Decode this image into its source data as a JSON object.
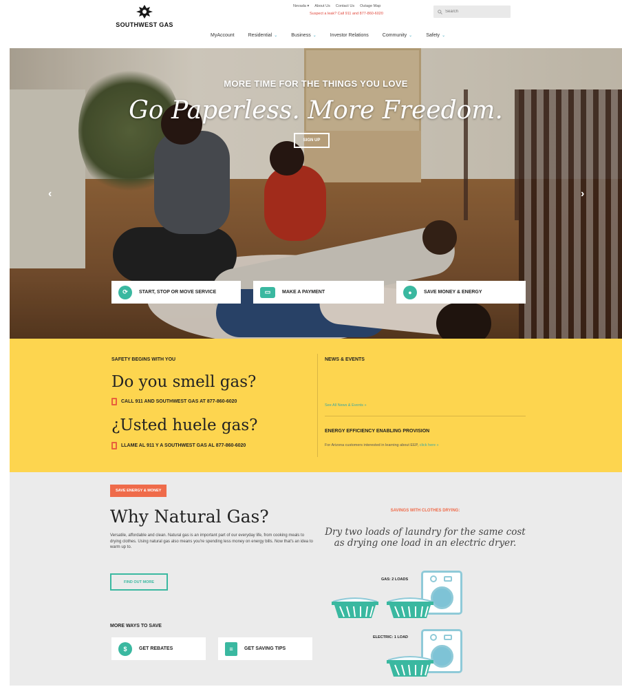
{
  "header": {
    "logo_text": "SOUTHWEST GAS",
    "utility_links": [
      "Nevada ▾",
      "About Us",
      "Contact Us",
      "Outage Map"
    ],
    "leak_notice": "Suspect a leak? Call 911 and 877-860-6020",
    "search_placeholder": "Search",
    "nav": [
      {
        "label": "MyAccount",
        "caret": ""
      },
      {
        "label": "Residential",
        "caret": "⌄"
      },
      {
        "label": "Business",
        "caret": "⌄"
      },
      {
        "label": "Investor Relations",
        "caret": ""
      },
      {
        "label": "Community",
        "caret": "⌄"
      },
      {
        "label": "Safety",
        "caret": "⌄"
      }
    ]
  },
  "hero": {
    "eyebrow": "MORE TIME FOR THE THINGS YOU LOVE",
    "title": "Go Paperless. More Freedom.",
    "cta": "SIGN UP",
    "prev": "‹",
    "next": "›",
    "tiles": [
      {
        "label": "START, STOP OR MOVE SERVICE",
        "icon": "service-icon"
      },
      {
        "label": "MAKE A PAYMENT",
        "icon": "payment-icon"
      },
      {
        "label": "SAVE MONEY & ENERGY",
        "icon": "piggy-bank-icon"
      }
    ]
  },
  "safety": {
    "eyebrow": "SAFETY BEGINS WITH YOU",
    "title_en": "Do you smell gas?",
    "call_en": "CALL 911 AND SOUTHWEST GAS AT 877-860-6020",
    "title_es": "¿Usted huele gas?",
    "call_es": "LLAME AL 911 Y A SOUTHWEST GAS AL 877-860-6020",
    "news_heading": "NEWS & EVENTS",
    "news_link": "See All News & Events »",
    "eep_heading": "ENERGY EFFICIENCY ENABLING PROVISION",
    "eep_text": "For Arizona customers interested in learning about EEP,",
    "eep_link": "click here »"
  },
  "save": {
    "tag": "SAVE ENERGY & MONEY",
    "title": "Why Natural Gas?",
    "body": "Versatile, affordable and clean. Natural gas is an important part of our everyday life, from cooking meals to drying clothes. Using natural gas also means you're spending less money on energy bills. Now that's an idea to warm up to.",
    "cta": "FIND OUT MORE",
    "more_heading": "MORE WAYS TO SAVE",
    "tiles": [
      {
        "label": "GET REBATES",
        "icon": "dollar-icon"
      },
      {
        "label": "GET SAVING TIPS",
        "icon": "tips-icon"
      }
    ],
    "savings_heading": "SAVINGS WITH CLOTHES DRYING:",
    "savings_text": "Dry two loads of laundry for the same cost as drying one load in an electric dryer.",
    "gas_label": "GAS: 2 LOADS",
    "electric_label": "ELECTRIC: 1 LOAD"
  },
  "colors": {
    "accent_teal": "#3ab8a0",
    "safety_yellow": "#fdd54f",
    "orange": "#ef6b4a",
    "leak_red": "#e0483c"
  }
}
